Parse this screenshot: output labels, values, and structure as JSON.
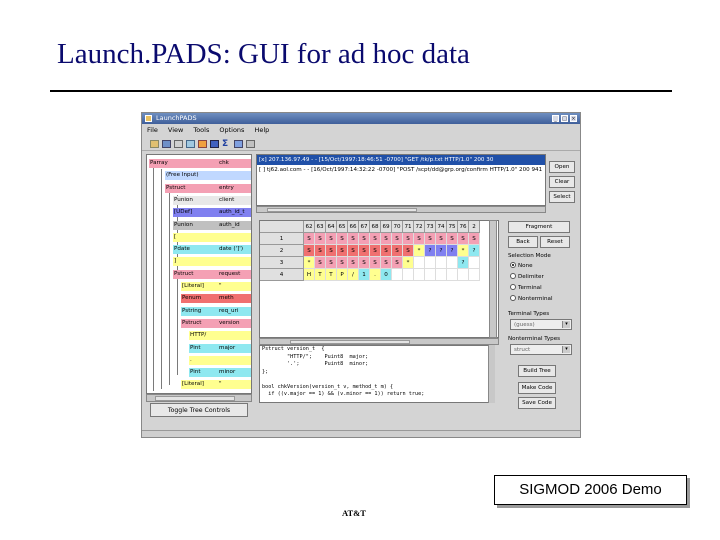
{
  "slide": {
    "title": "Launch.PADS: GUI for ad hoc data",
    "badge": "SIGMOD 2006 Demo",
    "footer": "AT&T"
  },
  "window": {
    "title": "LaunchPADS",
    "menu": [
      "File",
      "View",
      "Tools",
      "Options",
      "Help"
    ]
  },
  "tree": {
    "nodes": [
      {
        "label": "Parray",
        "value": "chk",
        "color": "#f4a0b4"
      },
      {
        "label": "(Free Input)",
        "value": "",
        "color": "#c0d8ff"
      },
      {
        "label": "Pstruct",
        "value": "entry",
        "color": "#f4a0b4"
      },
      {
        "label": "Punion",
        "value": "client",
        "color": "#e8e8e8"
      },
      {
        "label": "[UDef]",
        "value": "auth_id_t",
        "color": "#8080f0"
      },
      {
        "label": "Punion",
        "value": "auth_id",
        "color": "#c0c0c0"
      },
      {
        "label": "[",
        "value": "",
        "color": "#ffff90"
      },
      {
        "label": "Pdate",
        "value": "date (']')",
        "color": "#8fe8f0"
      },
      {
        "label": "]",
        "value": "",
        "color": "#ffff90"
      },
      {
        "label": "Pstruct",
        "value": "request",
        "color": "#f4a0b4"
      },
      {
        "label": "[Literal]",
        "value": "\"",
        "color": "#ffff90"
      },
      {
        "label": "Penum",
        "value": "meth",
        "color": "#f07070"
      },
      {
        "label": "Pstring",
        "value": "req_uri",
        "color": "#8fe8f0"
      },
      {
        "label": "Pstruct",
        "value": "version",
        "color": "#f4a0b4"
      },
      {
        "label": "HTTP/",
        "value": "",
        "color": "#ffff90"
      },
      {
        "label": "Pint",
        "value": "major",
        "color": "#8fe8f0"
      },
      {
        "label": ".",
        "value": "",
        "color": "#ffff90"
      },
      {
        "label": "Pint",
        "value": "minor",
        "color": "#8fe8f0"
      },
      {
        "label": "[Literal]",
        "value": "\"",
        "color": "#ffff90"
      }
    ],
    "toggle_label": "Toggle Tree Controls"
  },
  "records": [
    "[x] 207.136.97.49 - - [15/Oct/1997:18:46:51 -0700] \"GET /tk/p.txt HTTP/1.0\" 200 30",
    "[ ] tj62.aol.com - - [16/Oct/1997:14:32:22 -0700] \"POST /scpt/dd@grp.org/confirm HTTP/1.0\" 200 941"
  ],
  "record_buttons": {
    "open": "Open",
    "clear": "Clear",
    "select": "Select"
  },
  "grid": {
    "columns": [
      "1",
      "62",
      "63",
      "64",
      "65",
      "66",
      "67",
      "68",
      "69",
      "70",
      "71",
      "72",
      "73",
      "74",
      "75",
      "76",
      "2"
    ],
    "rows": [
      {
        "label": "1",
        "cells": [
          "S",
          "S",
          "S",
          "S",
          "S",
          "S",
          "S",
          "S",
          "S",
          "S",
          "S",
          "S",
          "S",
          "S",
          "S",
          "S"
        ],
        "colors": [
          "#f4a0b4",
          "#f4a0b4",
          "#f4a0b4",
          "#f4a0b4",
          "#f4a0b4",
          "#f4a0b4",
          "#f4a0b4",
          "#f4a0b4",
          "#f4a0b4",
          "#f4a0b4",
          "#f4a0b4",
          "#f4a0b4",
          "#f4a0b4",
          "#f4a0b4",
          "#f4a0b4",
          "#f4a0b4"
        ]
      },
      {
        "label": "2",
        "cells": [
          "S",
          "S",
          "S",
          "S",
          "S",
          "S",
          "S",
          "S",
          "S",
          "S",
          "*",
          "?",
          "?",
          "?",
          "*",
          "?"
        ],
        "colors": [
          "#f07070",
          "#f07070",
          "#f07070",
          "#f07070",
          "#f07070",
          "#f07070",
          "#f07070",
          "#f07070",
          "#f07070",
          "#f07070",
          "#ffff90",
          "#8080f0",
          "#8080f0",
          "#8080f0",
          "#ffff90",
          "#8fe8f0"
        ]
      },
      {
        "label": "3",
        "cells": [
          "*",
          "S",
          "S",
          "S",
          "S",
          "S",
          "S",
          "S",
          "S",
          "*",
          "",
          "",
          "",
          "",
          "?",
          ""
        ],
        "colors": [
          "#ffff90",
          "#f4a0b4",
          "#f4a0b4",
          "#f4a0b4",
          "#f4a0b4",
          "#f4a0b4",
          "#f4a0b4",
          "#f4a0b4",
          "#f4a0b4",
          "#ffff90",
          "#ffffff",
          "#ffffff",
          "#ffffff",
          "#ffffff",
          "#8fe8f0",
          "#ffffff"
        ]
      },
      {
        "label": "4",
        "cells": [
          "H",
          "T",
          "T",
          "P",
          "/",
          "1",
          ".",
          "0",
          "",
          "",
          "",
          "",
          "",
          "",
          "",
          ""
        ],
        "colors": [
          "#ffff90",
          "#ffff90",
          "#ffff90",
          "#ffff90",
          "#ffff90",
          "#8fe8f0",
          "#ffff90",
          "#8fe8f0",
          "#ffffff",
          "#ffffff",
          "#ffffff",
          "#ffffff",
          "#ffffff",
          "#ffffff",
          "#ffffff",
          "#ffffff"
        ]
      }
    ]
  },
  "controls": {
    "fragment": "Fragment",
    "back": "Back",
    "reset": "Reset",
    "selection_mode_label": "Selection Mode",
    "modes": [
      "None",
      "Delimiter",
      "Terminal",
      "Nonterminal"
    ],
    "selected_mode": "None",
    "terminal_types_label": "Terminal Types",
    "terminal_types_value": "(guess)",
    "nonterminal_types_label": "Nonterminal Types",
    "nonterminal_types_value": "struct",
    "build_tree": "Build Tree",
    "make_code": "Make Code",
    "save_code": "Save Code"
  },
  "code_lines": [
    "Pstruct version_t  {",
    "        \"HTTP/\";    Puint8  major;",
    "        '.';        Puint8  minor;",
    "};",
    "",
    "bool chkVersion(version_t v, method_t m) {",
    "  if ((v.major == 1) && (v.minor == 1)) return true;"
  ],
  "colors": {
    "title": "#0a0a6e",
    "selection": "#2050a8",
    "struct": "#f4a0b4",
    "literal": "#ffff90",
    "base": "#8fe8f0",
    "udef": "#8080f0",
    "enum": "#f07070"
  }
}
